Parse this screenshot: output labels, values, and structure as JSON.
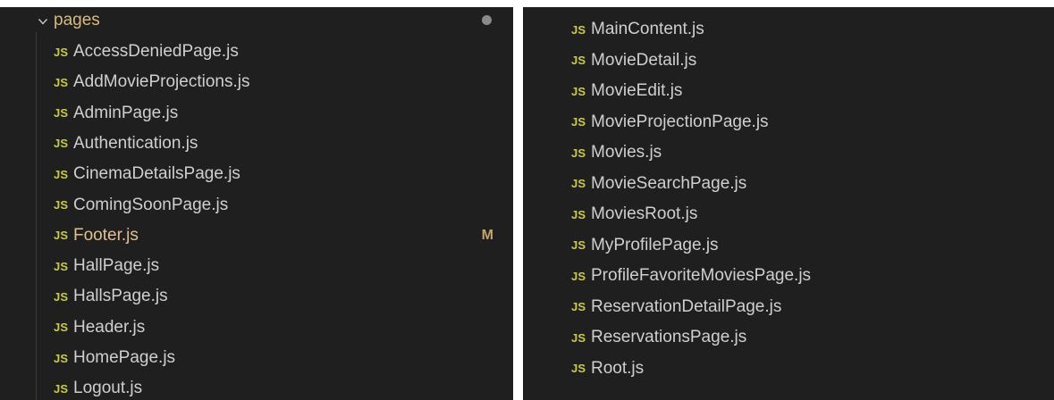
{
  "colors": {
    "js_icon": "#cbcb41",
    "folder_dot": "#8a8a8a",
    "modified": "#e2c08d",
    "badge": "#c4a56b"
  },
  "left_panel": {
    "folder": {
      "name": "pages",
      "icon": "chevron-down-icon"
    },
    "files": [
      {
        "icon": "JS",
        "name": "AccessDeniedPage.js"
      },
      {
        "icon": "JS",
        "name": "AddMovieProjections.js"
      },
      {
        "icon": "JS",
        "name": "AdminPage.js"
      },
      {
        "icon": "JS",
        "name": "Authentication.js"
      },
      {
        "icon": "JS",
        "name": "CinemaDetailsPage.js"
      },
      {
        "icon": "JS",
        "name": "ComingSoonPage.js"
      },
      {
        "icon": "JS",
        "name": "Footer.js",
        "status": "M"
      },
      {
        "icon": "JS",
        "name": "HallPage.js"
      },
      {
        "icon": "JS",
        "name": "HallsPage.js"
      },
      {
        "icon": "JS",
        "name": "Header.js"
      },
      {
        "icon": "JS",
        "name": "HomePage.js"
      },
      {
        "icon": "JS",
        "name": "Logout.js"
      }
    ]
  },
  "right_panel": {
    "files": [
      {
        "icon": "JS",
        "name": "MainContent.js"
      },
      {
        "icon": "JS",
        "name": "MovieDetail.js"
      },
      {
        "icon": "JS",
        "name": "MovieEdit.js"
      },
      {
        "icon": "JS",
        "name": "MovieProjectionPage.js"
      },
      {
        "icon": "JS",
        "name": "Movies.js"
      },
      {
        "icon": "JS",
        "name": "MovieSearchPage.js"
      },
      {
        "icon": "JS",
        "name": "MoviesRoot.js"
      },
      {
        "icon": "JS",
        "name": "MyProfilePage.js"
      },
      {
        "icon": "JS",
        "name": "ProfileFavoriteMoviesPage.js"
      },
      {
        "icon": "JS",
        "name": "ReservationDetailPage.js"
      },
      {
        "icon": "JS",
        "name": "ReservationsPage.js"
      },
      {
        "icon": "JS",
        "name": "Root.js"
      }
    ]
  }
}
